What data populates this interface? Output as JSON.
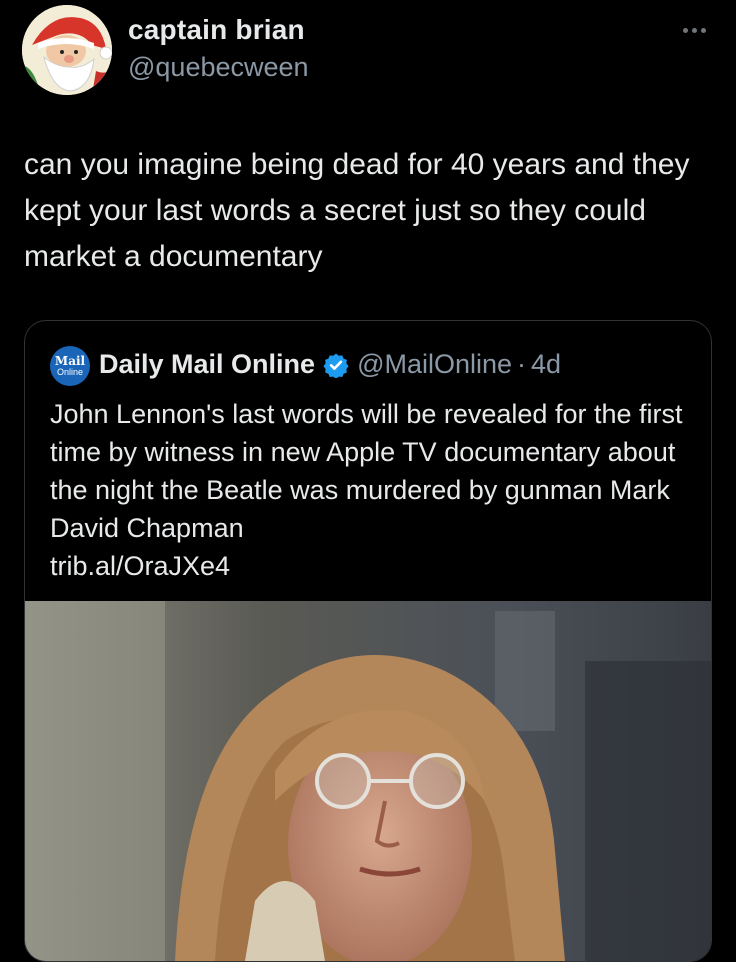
{
  "tweet": {
    "display_name": "captain brian",
    "handle": "@quebecween",
    "text": "can you imagine being dead for 40 years and they kept your last words a secret just so they could market a documentary",
    "more_icon": "ellipsis-horizontal-icon"
  },
  "quoted_tweet": {
    "logo_line1": "Mail",
    "logo_line2": "Online",
    "display_name": "Daily Mail Online",
    "verified_icon": "verified-badge-icon",
    "handle": "@MailOnline",
    "separator": "·",
    "time": "4d",
    "text": "John Lennon's last words will be revealed for the first time by witness in new Apple TV documentary about the night the Beatle was murdered by gunman Mark David Chapman",
    "link": "trib.al/OraJXe4"
  },
  "colors": {
    "background": "#000000",
    "primary_text": "#e7e9ea",
    "secondary_text": "#8b98a5",
    "border": "#2f3336",
    "verified": "#1d9bf0",
    "mail_logo": "#1a65b8"
  }
}
